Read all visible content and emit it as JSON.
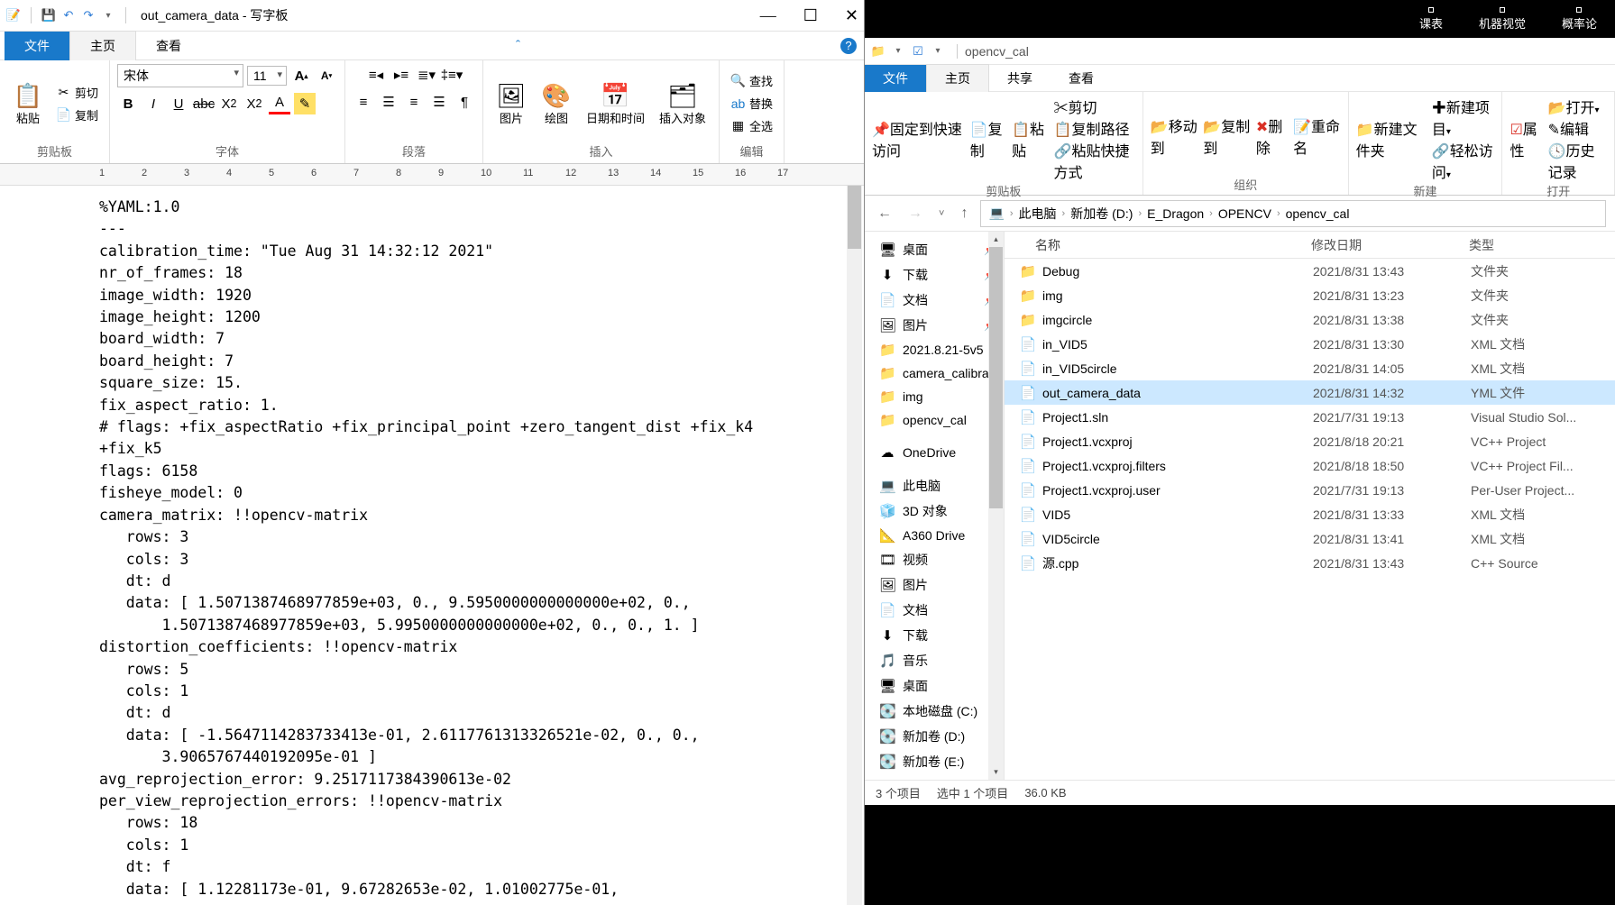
{
  "wordpad": {
    "title": "out_camera_data - 写字板",
    "tabs": {
      "file": "文件",
      "home": "主页",
      "view": "查看"
    },
    "ribbon": {
      "clipboard": {
        "paste": "粘贴",
        "cut": "剪切",
        "copy": "复制",
        "label": "剪贴板"
      },
      "font": {
        "family": "宋体",
        "size": "11",
        "label": "字体"
      },
      "paragraph": {
        "label": "段落"
      },
      "insert": {
        "picture": "图片",
        "draw": "绘图",
        "datetime": "日期和时间",
        "object": "插入对象",
        "label": "插入"
      },
      "edit": {
        "find": "查找",
        "replace": "替换",
        "selectall": "全选",
        "label": "编辑"
      }
    },
    "ruler_ticks": [
      "1",
      "2",
      "3",
      "4",
      "5",
      "6",
      "7",
      "8",
      "9",
      "10",
      "11",
      "12",
      "13",
      "14",
      "15",
      "16",
      "17"
    ],
    "doc": "%YAML:1.0\n---\ncalibration_time: \"Tue Aug 31 14:32:12 2021\"\nnr_of_frames: 18\nimage_width: 1920\nimage_height: 1200\nboard_width: 7\nboard_height: 7\nsquare_size: 15.\nfix_aspect_ratio: 1.\n# flags: +fix_aspectRatio +fix_principal_point +zero_tangent_dist +fix_k4\n+fix_k5\nflags: 6158\nfisheye_model: 0\ncamera_matrix: !!opencv-matrix\n   rows: 3\n   cols: 3\n   dt: d\n   data: [ 1.5071387468977859e+03, 0., 9.5950000000000000e+02, 0.,\n       1.5071387468977859e+03, 5.9950000000000000e+02, 0., 0., 1. ]\ndistortion_coefficients: !!opencv-matrix\n   rows: 5\n   cols: 1\n   dt: d\n   data: [ -1.5647114283733413e-01, 2.6117761313326521e-02, 0., 0.,\n       3.9065767440192095e-01 ]\navg_reprojection_error: 9.2517117384390613e-02\nper_view_reprojection_errors: !!opencv-matrix\n   rows: 18\n   cols: 1\n   dt: f\n   data: [ 1.12281173e-01, 9.67282653e-02, 1.01002775e-01,"
  },
  "blackbar": {
    "items": [
      "课表",
      "机器视觉",
      "概率论"
    ]
  },
  "explorer": {
    "title": "opencv_cal",
    "tabs": {
      "file": "文件",
      "home": "主页",
      "share": "共享",
      "view": "查看"
    },
    "ribbon": {
      "clipboard": {
        "pin": "固定到快速访问",
        "copy": "复制",
        "paste": "粘贴",
        "cut": "剪切",
        "copypath": "复制路径",
        "shortcut": "粘贴快捷方式",
        "label": "剪贴板"
      },
      "organize": {
        "moveto": "移动到",
        "copyto": "复制到",
        "delete": "删除",
        "rename": "重命名",
        "label": "组织"
      },
      "new": {
        "folder": "新建文件夹",
        "newitem": "新建项目",
        "easy": "轻松访问",
        "label": "新建"
      },
      "open": {
        "props": "属性",
        "open": "打开",
        "edit": "编辑",
        "history": "历史记录",
        "label": "打开"
      }
    },
    "crumbs": [
      "此电脑",
      "新加卷 (D:)",
      "E_Dragon",
      "OPENCV",
      "opencv_cal"
    ],
    "nav": {
      "quick": [
        {
          "icon": "🖥",
          "label": "桌面",
          "pin": true
        },
        {
          "icon": "⬇",
          "label": "下载",
          "pin": true
        },
        {
          "icon": "📄",
          "label": "文档",
          "pin": true
        },
        {
          "icon": "🖼",
          "label": "图片",
          "pin": true
        },
        {
          "icon": "📁",
          "label": "2021.8.21-5v5"
        },
        {
          "icon": "📁",
          "label": "camera_calibra"
        },
        {
          "icon": "📁",
          "label": "img"
        },
        {
          "icon": "📁",
          "label": "opencv_cal"
        }
      ],
      "onedrive": {
        "icon": "☁",
        "label": "OneDrive"
      },
      "pc": [
        {
          "icon": "💻",
          "label": "此电脑"
        },
        {
          "icon": "🧊",
          "label": "3D 对象"
        },
        {
          "icon": "📐",
          "label": "A360 Drive"
        },
        {
          "icon": "🎞",
          "label": "视频"
        },
        {
          "icon": "🖼",
          "label": "图片"
        },
        {
          "icon": "📄",
          "label": "文档"
        },
        {
          "icon": "⬇",
          "label": "下载"
        },
        {
          "icon": "🎵",
          "label": "音乐"
        },
        {
          "icon": "🖥",
          "label": "桌面"
        },
        {
          "icon": "💽",
          "label": "本地磁盘 (C:)"
        },
        {
          "icon": "💽",
          "label": "新加卷 (D:)"
        },
        {
          "icon": "💽",
          "label": "新加卷 (E:)"
        }
      ]
    },
    "cols": {
      "name": "名称",
      "date": "修改日期",
      "type": "类型"
    },
    "files": [
      {
        "icon": "📁",
        "cls": "folder-ico",
        "name": "Debug",
        "date": "2021/8/31 13:43",
        "type": "文件夹"
      },
      {
        "icon": "📁",
        "cls": "folder-ico",
        "name": "img",
        "date": "2021/8/31 13:23",
        "type": "文件夹"
      },
      {
        "icon": "📁",
        "cls": "folder-ico",
        "name": "imgcircle",
        "date": "2021/8/31 13:38",
        "type": "文件夹"
      },
      {
        "icon": "📄",
        "cls": "xml-ico",
        "name": "in_VID5",
        "date": "2021/8/31 13:30",
        "type": "XML 文档"
      },
      {
        "icon": "📄",
        "cls": "xml-ico",
        "name": "in_VID5circle",
        "date": "2021/8/31 14:05",
        "type": "XML 文档"
      },
      {
        "icon": "📄",
        "cls": "file-ico",
        "name": "out_camera_data",
        "date": "2021/8/31 14:32",
        "type": "YML 文件",
        "selected": true
      },
      {
        "icon": "📄",
        "cls": "file-ico",
        "name": "Project1.sln",
        "date": "2021/7/31 19:13",
        "type": "Visual Studio Sol..."
      },
      {
        "icon": "📄",
        "cls": "file-ico",
        "name": "Project1.vcxproj",
        "date": "2021/8/18 20:21",
        "type": "VC++ Project"
      },
      {
        "icon": "📄",
        "cls": "file-ico",
        "name": "Project1.vcxproj.filters",
        "date": "2021/8/18 18:50",
        "type": "VC++ Project Fil..."
      },
      {
        "icon": "📄",
        "cls": "file-ico",
        "name": "Project1.vcxproj.user",
        "date": "2021/7/31 19:13",
        "type": "Per-User Project..."
      },
      {
        "icon": "📄",
        "cls": "xml-ico",
        "name": "VID5",
        "date": "2021/8/31 13:33",
        "type": "XML 文档"
      },
      {
        "icon": "📄",
        "cls": "xml-ico",
        "name": "VID5circle",
        "date": "2021/8/31 13:41",
        "type": "XML 文档"
      },
      {
        "icon": "📄",
        "cls": "cpp-ico",
        "name": "源.cpp",
        "date": "2021/8/31 13:43",
        "type": "C++ Source"
      }
    ],
    "status": {
      "count": "3 个项目",
      "selected": "选中 1 个项目",
      "size": "36.0 KB"
    }
  }
}
